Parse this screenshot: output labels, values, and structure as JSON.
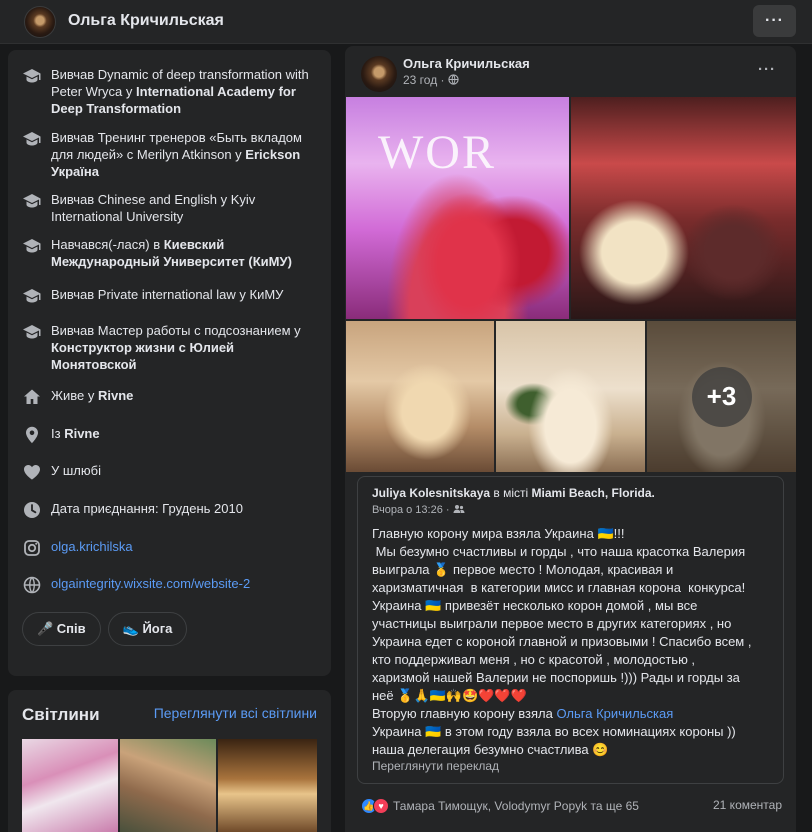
{
  "header": {
    "name": "Ольга Кричильская"
  },
  "intro": {
    "items": [
      {
        "icon": "graduation-cap-icon",
        "pre": "Вивчав Dynamic of deep transformation with Peter Wryca у ",
        "bold": "International Academy for Deep Transformation"
      },
      {
        "icon": "graduation-cap-icon",
        "pre": "Вивчав Тренинг тренеров «Быть вкладом для людей» с Merilyn Atkinson у ",
        "bold": "Erickson Україна"
      },
      {
        "icon": "graduation-cap-icon",
        "pre": "Вивчав Chinese and English у Kyiv International University",
        "bold": ""
      },
      {
        "icon": "graduation-cap-icon",
        "pre": "Навчався(-лася) в ",
        "bold": "Киевский Международный Университет (КиМУ)"
      },
      {
        "icon": "graduation-cap-icon",
        "pre": "Вивчав Private international law у КиМУ",
        "bold": ""
      },
      {
        "icon": "graduation-cap-icon",
        "pre": "Вивчав Мастер работы с подсознанием у ",
        "bold": "Конструктор жизни с Юлией Монятовской"
      },
      {
        "icon": "home-icon",
        "pre": "Живе у ",
        "bold": "Rivne"
      },
      {
        "icon": "location-pin-icon",
        "pre": "Із ",
        "bold": "Rivne"
      },
      {
        "icon": "heart-icon",
        "pre": "У шлюбі",
        "bold": ""
      },
      {
        "icon": "clock-icon",
        "pre": "Дата приєднання: Грудень 2010",
        "bold": ""
      }
    ],
    "instagram": "olga.krichilska",
    "website": "olgaintegrity.wixsite.com/website-2",
    "chips": [
      "🎤 Спів",
      "👟 Йога"
    ]
  },
  "photos": {
    "title": "Світлини",
    "see_all": "Переглянути всі світлини"
  },
  "post": {
    "author": "Ольга Кричильская",
    "time": "23 год · ",
    "more_photos": "+3",
    "shared": {
      "author": "Juliya Kolesnitskaya",
      "in_city": " в місті ",
      "city": "Miami Beach, Florida.",
      "time": "Вчора о 13:26 · ",
      "lines": [
        "Главную корону мира взяла Украина 🇺🇦!!!",
        " Мы безумно счастливы и горды , что наша красотка Валерия",
        "выиграла 🥇 первое место ! Молодая, красивая и",
        "харизматичная  в категории мисс и главная корона  конкурса!",
        "Украина 🇺🇦 привезёт несколько корон домой , мы все",
        "участницы выиграли первое место в других категориях , но",
        "Украина едет с короной главной и призовыми ! Спасибо всем ,",
        "кто поддерживал меня , но с красотой , молодостью ,",
        "харизмой нашей Валерии не поспоришь !))) Рады и горды за",
        "неё 🥇🙏🇺🇦🙌🤩❤️❤️❤️"
      ],
      "mention_pre": "Вторую главную корону взяла ",
      "mention": "Ольга Кричильская",
      "tail": [
        "Украина 🇺🇦 в этом году взяла во всех номинациях короны ))",
        "наша делегация безумно счастлива 😊"
      ],
      "translate": "Переглянути переклад"
    },
    "reactions": "Тамара Тимощук, Volodymyr Popyk та ще 65",
    "comments": "21 коментар"
  }
}
